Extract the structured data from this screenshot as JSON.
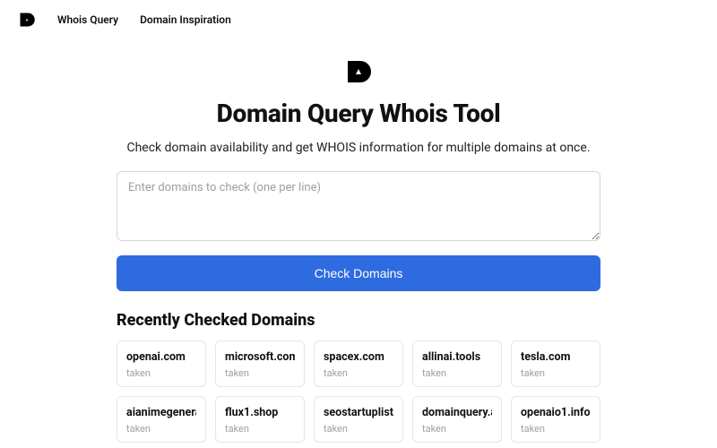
{
  "nav": {
    "links": [
      "Whois Query",
      "Domain Inspiration"
    ]
  },
  "hero": {
    "title": "Domain Query Whois Tool",
    "subtitle": "Check domain availability and get WHOIS information for multiple domains at once."
  },
  "form": {
    "placeholder": "Enter domains to check (one per line)",
    "button": "Check Domains"
  },
  "recent": {
    "title": "Recently Checked Domains",
    "items": [
      {
        "name": "openai.com",
        "status": "taken"
      },
      {
        "name": "microsoft.com",
        "status": "taken"
      },
      {
        "name": "spacex.com",
        "status": "taken"
      },
      {
        "name": "allinai.tools",
        "status": "taken"
      },
      {
        "name": "tesla.com",
        "status": "taken"
      },
      {
        "name": "aianimegenerator.app",
        "status": "taken"
      },
      {
        "name": "flux1.shop",
        "status": "taken"
      },
      {
        "name": "seostartuplist.com",
        "status": "taken"
      },
      {
        "name": "domainquery.app",
        "status": "taken"
      },
      {
        "name": "openaio1.info",
        "status": "taken"
      }
    ]
  }
}
